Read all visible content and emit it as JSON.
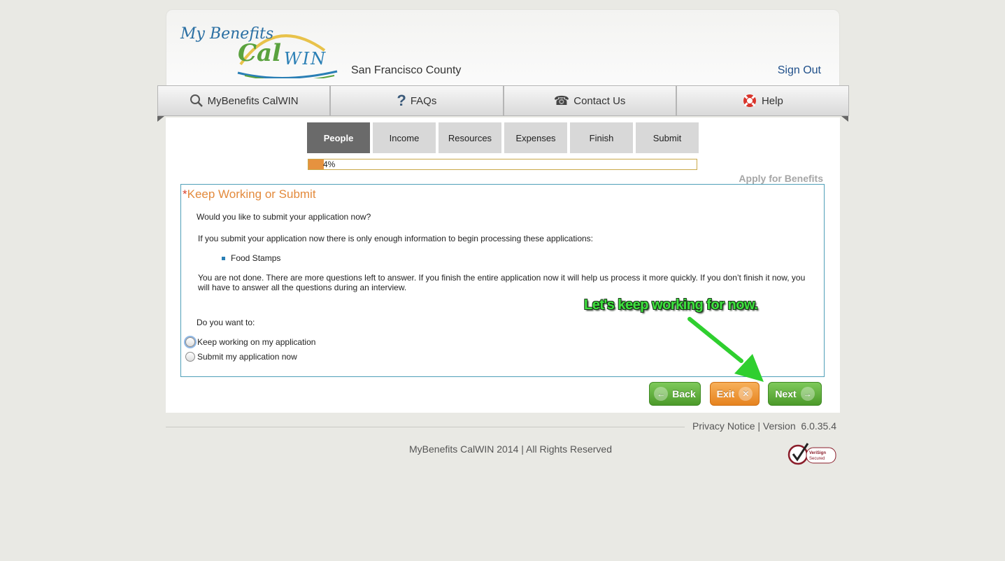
{
  "header": {
    "logo_text_my": "My Benefits",
    "logo_text_cal": "Cal",
    "logo_text_win": "WIN",
    "county": "San Francisco County",
    "signout_label": "Sign Out"
  },
  "nav": {
    "items": [
      {
        "label": "MyBenefits CalWIN",
        "icon": "search-icon"
      },
      {
        "label": "FAQs",
        "icon": "question-icon"
      },
      {
        "label": "Contact Us",
        "icon": "phone-icon"
      },
      {
        "label": "Help",
        "icon": "lifebuoy-icon"
      }
    ]
  },
  "steps": [
    "People",
    "Income",
    "Resources",
    "Expenses",
    "Finish",
    "Submit"
  ],
  "active_step": "People",
  "progress": {
    "label": "4%",
    "value_percent": 4
  },
  "apply_label": "Apply for Benefits",
  "panel": {
    "title_star": "*",
    "title": "Keep Working or Submit",
    "question": "Would you like to submit your application now?",
    "info": "If you submit your application now there is only enough information to begin processing these applications:",
    "applications": [
      "Food Stamps"
    ],
    "note": "You are not done. There are more questions left to answer. If you finish the entire application now it will help us process it more quickly. If you don’t finish it now, you will have to answer all the questions during an interview.",
    "prompt": "Do you want to:",
    "options": [
      "Keep working on my application",
      "Submit my application now"
    ]
  },
  "callout": "Let's keep working for now.",
  "buttons": {
    "back": "Back",
    "exit": "Exit",
    "next": "Next"
  },
  "footer": {
    "privacy": "Privacy Notice",
    "separator": "|",
    "version": "Version  6.0.35.4",
    "copyright": "MyBenefits CalWIN 2014 | All Rights Reserved",
    "verisign": "VeriSign Secured"
  },
  "colors": {
    "accent_orange": "#e38a3c",
    "panel_border": "#4f9fb8",
    "green_button": "#5aa835",
    "orange_button": "#ec8f2b",
    "callout_green": "#3ee23e"
  }
}
